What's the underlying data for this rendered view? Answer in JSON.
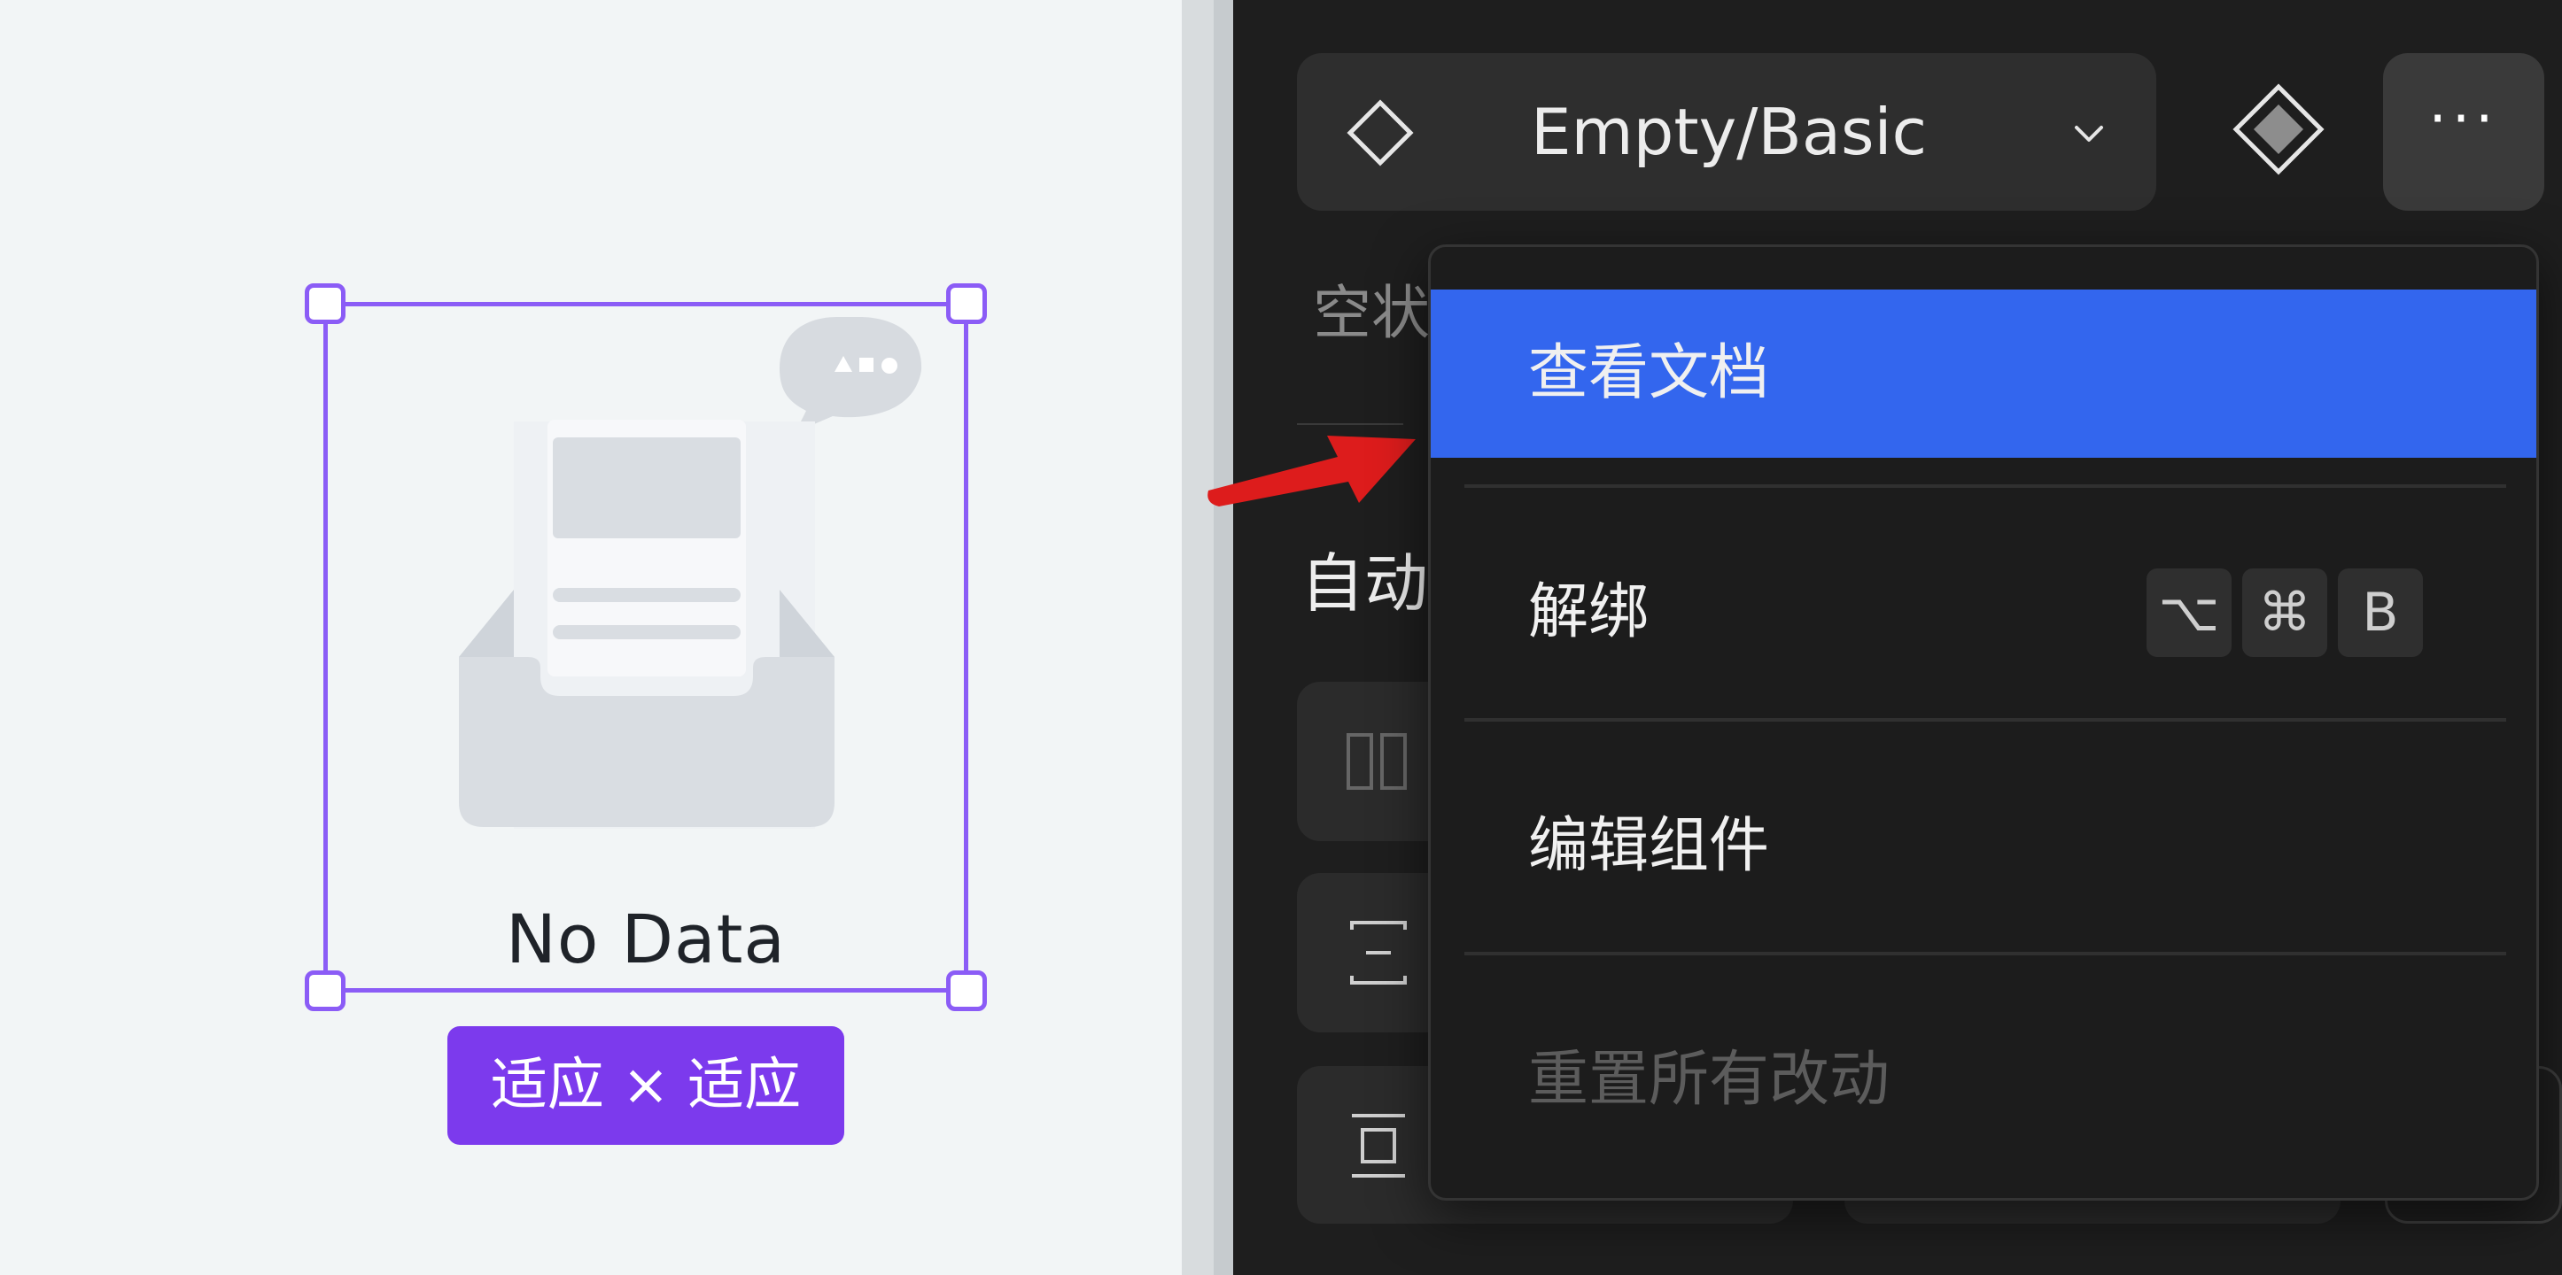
{
  "canvas": {
    "empty_state": {
      "title": "No Data"
    },
    "size_badge": "适应 × 适应"
  },
  "panel": {
    "component_selector": {
      "label": "Empty/Basic"
    },
    "more_button_label": "···",
    "description_partial": "空状",
    "auto_layout_partial": "自动"
  },
  "context_menu": {
    "items": [
      {
        "label": "查看文档",
        "state": "highlighted"
      },
      {
        "label": "解绑",
        "shortcut": [
          "⌥",
          "⌘",
          "B"
        ]
      },
      {
        "label": "编辑组件"
      },
      {
        "label": "重置所有改动",
        "state": "disabled"
      }
    ]
  },
  "colors": {
    "selection": "#8b5cf6",
    "badge": "#7c3aed",
    "menu_highlight": "#3366ee",
    "annotation_arrow": "#dd1c1c"
  }
}
